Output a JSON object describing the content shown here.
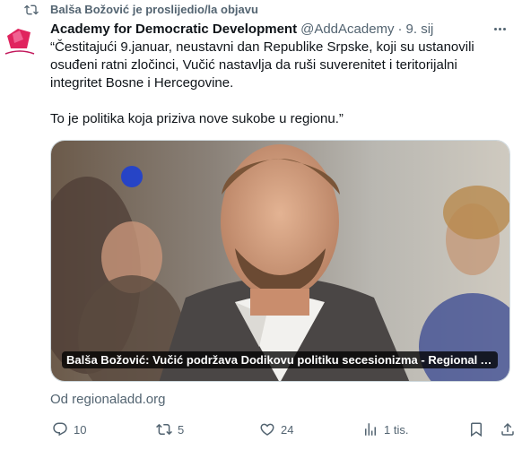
{
  "repost_banner": {
    "text": "Balša Božović je proslijedio/la objavu",
    "icon": "repost-icon"
  },
  "post": {
    "author_name": "Academy for Democratic Development",
    "author_handle": "@AddAcademy",
    "separator": "·",
    "date": "9. sij",
    "text": "“Čestitajući 9.januar, neustavni dan Republike Srpske, koji su ustanovili osuđeni ratni zločinci, Vučić nastavlja da ruši suverenitet i teritorijalni integritet Bosne i Hercegovine.\n\nTo je politika koja priziva nove sukobe u regionu.”",
    "card_caption": "Balša Božović: Vučić podržava Dodikovu politiku secesionizma - Regional Acad...",
    "source": "Od regionaladd.org"
  },
  "actions": {
    "replies": "10",
    "reposts": "5",
    "likes": "24",
    "views": "1 tis."
  },
  "colors": {
    "text": "#0f1419",
    "muted": "#536471",
    "border": "#cfd9de",
    "avatar_accent": "#e0245e"
  }
}
